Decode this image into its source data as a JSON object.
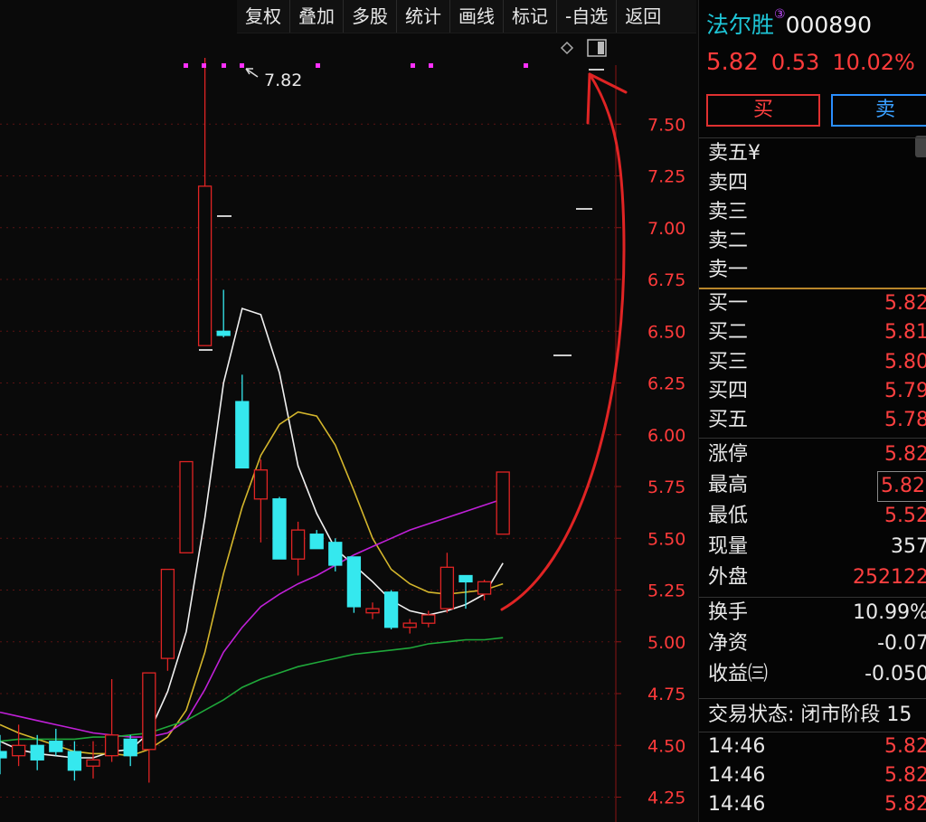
{
  "toolbar": {
    "items": [
      "复权",
      "叠加",
      "多股",
      "统计",
      "画线",
      "标记",
      "-自选",
      "返回"
    ]
  },
  "stock": {
    "name": "法尔胜",
    "badge": "③",
    "code": "000890",
    "price": "5.82",
    "change": "0.53",
    "change_pct": "10.02%"
  },
  "actions": {
    "buy": "买",
    "sell": "卖"
  },
  "order_book": {
    "asks": [
      {
        "label": "卖五",
        "suffix": "¥"
      },
      {
        "label": "卖四"
      },
      {
        "label": "卖三"
      },
      {
        "label": "卖二"
      },
      {
        "label": "卖一"
      }
    ],
    "bids": [
      {
        "label": "买一",
        "price": "5.82"
      },
      {
        "label": "买二",
        "price": "5.81"
      },
      {
        "label": "买三",
        "price": "5.80"
      },
      {
        "label": "买四",
        "price": "5.79"
      },
      {
        "label": "买五",
        "price": "5.78"
      }
    ]
  },
  "stats": [
    {
      "label": "涨停",
      "value": "5.82"
    },
    {
      "label": "最高",
      "value": "5.82"
    },
    {
      "label": "最低",
      "value": "5.52"
    },
    {
      "label": "现量",
      "value": "357"
    },
    {
      "label": "外盘",
      "value": "252122"
    }
  ],
  "stats2": [
    {
      "label": "换手",
      "value": "10.99%"
    },
    {
      "label": "净资",
      "value": "-0.07"
    },
    {
      "label": "收益㈢",
      "value": "-0.050"
    }
  ],
  "trade_status": "交易状态: 闭市阶段 15",
  "ticks": [
    {
      "time": "14:46",
      "price": "5.82"
    },
    {
      "time": "14:46",
      "price": "5.82"
    },
    {
      "time": "14:46",
      "price": "5.82"
    }
  ],
  "chart_data": {
    "type": "candlestick",
    "y_axis_ticks": [
      "7.50",
      "7.25",
      "7.00",
      "6.75",
      "6.50",
      "6.25",
      "6.00",
      "5.75",
      "5.50",
      "5.25",
      "5.00",
      "4.75",
      "4.50",
      "4.25"
    ],
    "high_annotation": "7.82",
    "ylim": [
      4.25,
      7.82
    ],
    "candles": [
      {
        "o": 4.47,
        "h": 4.55,
        "l": 4.36,
        "c": 4.44
      },
      {
        "o": 4.45,
        "h": 4.6,
        "l": 4.4,
        "c": 4.5
      },
      {
        "o": 4.5,
        "h": 4.55,
        "l": 4.38,
        "c": 4.43
      },
      {
        "o": 4.52,
        "h": 4.58,
        "l": 4.45,
        "c": 4.47
      },
      {
        "o": 4.47,
        "h": 4.52,
        "l": 4.33,
        "c": 4.38
      },
      {
        "o": 4.4,
        "h": 4.52,
        "l": 4.34,
        "c": 4.43
      },
      {
        "o": 4.45,
        "h": 4.82,
        "l": 4.42,
        "c": 4.55
      },
      {
        "o": 4.53,
        "h": 4.55,
        "l": 4.4,
        "c": 4.45
      },
      {
        "o": 4.48,
        "h": 4.82,
        "l": 4.32,
        "c": 4.85
      },
      {
        "o": 4.92,
        "h": 5.35,
        "l": 4.86,
        "c": 5.35
      },
      {
        "o": 5.43,
        "h": 5.87,
        "l": 5.43,
        "c": 5.87
      },
      {
        "o": 6.43,
        "h": 7.82,
        "l": 6.43,
        "c": 7.2
      },
      {
        "o": 6.5,
        "h": 6.7,
        "l": 6.47,
        "c": 6.48
      },
      {
        "o": 6.16,
        "h": 6.29,
        "l": 5.84,
        "c": 5.84
      },
      {
        "o": 5.69,
        "h": 5.88,
        "l": 5.48,
        "c": 5.83
      },
      {
        "o": 5.69,
        "h": 5.7,
        "l": 5.4,
        "c": 5.4
      },
      {
        "o": 5.4,
        "h": 5.58,
        "l": 5.32,
        "c": 5.54
      },
      {
        "o": 5.52,
        "h": 5.54,
        "l": 5.45,
        "c": 5.45
      },
      {
        "o": 5.48,
        "h": 5.5,
        "l": 5.34,
        "c": 5.37
      },
      {
        "o": 5.41,
        "h": 5.41,
        "l": 5.14,
        "c": 5.17
      },
      {
        "o": 5.14,
        "h": 5.19,
        "l": 5.11,
        "c": 5.16
      },
      {
        "o": 5.24,
        "h": 5.25,
        "l": 5.06,
        "c": 5.07
      },
      {
        "o": 5.07,
        "h": 5.11,
        "l": 5.04,
        "c": 5.09
      },
      {
        "o": 5.09,
        "h": 5.15,
        "l": 5.07,
        "c": 5.13
      },
      {
        "o": 5.16,
        "h": 5.43,
        "l": 5.14,
        "c": 5.36
      },
      {
        "o": 5.32,
        "h": 5.32,
        "l": 5.16,
        "c": 5.29
      },
      {
        "o": 5.23,
        "h": 5.3,
        "l": 5.2,
        "c": 5.29
      },
      {
        "o": 5.52,
        "h": 5.82,
        "l": 5.52,
        "c": 5.82
      }
    ],
    "ma_lines": [
      {
        "color": "#f0f0f0",
        "values": [
          4.52,
          4.48,
          4.46,
          4.45,
          4.44,
          4.44,
          4.47,
          4.48,
          4.56,
          4.76,
          5.05,
          5.6,
          6.25,
          6.61,
          6.58,
          6.3,
          5.85,
          5.62,
          5.45,
          5.37,
          5.29,
          5.2,
          5.15,
          5.13,
          5.15,
          5.18,
          5.23,
          5.38
        ]
      },
      {
        "color": "#d4b62c",
        "values": [
          4.6,
          4.56,
          4.53,
          4.5,
          4.47,
          4.46,
          4.46,
          4.45,
          4.48,
          4.54,
          4.67,
          4.95,
          5.33,
          5.65,
          5.9,
          6.05,
          6.11,
          6.09,
          5.95,
          5.73,
          5.5,
          5.35,
          5.28,
          5.24,
          5.23,
          5.24,
          5.25,
          5.28
        ]
      },
      {
        "color": "#c020d8",
        "values": [
          4.66,
          4.64,
          4.62,
          4.6,
          4.58,
          4.56,
          4.55,
          4.54,
          4.54,
          4.56,
          4.62,
          4.77,
          4.95,
          5.07,
          5.17,
          5.23,
          5.28,
          5.32,
          5.37,
          5.42,
          5.46,
          5.5,
          5.54,
          5.57,
          5.6,
          5.63,
          5.66,
          5.69
        ]
      },
      {
        "color": "#1fa83a",
        "values": [
          4.52,
          4.53,
          4.53,
          4.53,
          4.53,
          4.54,
          4.54,
          4.55,
          4.56,
          4.59,
          4.62,
          4.67,
          4.72,
          4.78,
          4.82,
          4.85,
          4.88,
          4.9,
          4.92,
          4.94,
          4.95,
          4.96,
          4.97,
          4.99,
          5.0,
          5.01,
          5.01,
          5.02
        ]
      }
    ]
  }
}
